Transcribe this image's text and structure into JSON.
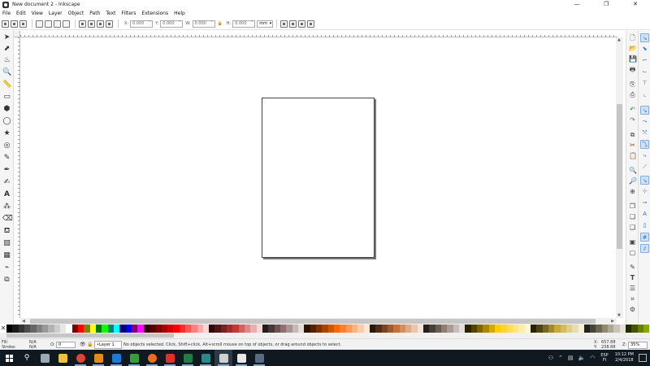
{
  "window": {
    "title": "New document 2 - Inkscape",
    "minimize": "—",
    "maximize": "❐",
    "close": "✕"
  },
  "menu": [
    "File",
    "Edit",
    "View",
    "Layer",
    "Object",
    "Path",
    "Text",
    "Filters",
    "Extensions",
    "Help"
  ],
  "controls": {
    "x_label": "X:",
    "x_value": "0.000",
    "y_label": "Y:",
    "y_value": "0.000",
    "w_label": "W:",
    "w_value": "0.000",
    "h_label": "H:",
    "h_value": "0.000",
    "unit": "mm"
  },
  "tools": [
    "selector-tool",
    "node-tool",
    "tweak-tool",
    "zoom-tool",
    "measure-tool",
    "rectangle-tool",
    "3d-box-tool",
    "ellipse-tool",
    "star-tool",
    "spiral-tool",
    "pencil-tool",
    "pen-tool",
    "calligraphy-tool",
    "text-tool",
    "spray-tool",
    "eraser-tool",
    "paint-bucket-tool",
    "gradient-tool",
    "mesh-tool",
    "dropper-tool",
    "connector-tool"
  ],
  "status": {
    "fill_label": "Fill:",
    "fill_value": "N/A",
    "stroke_label": "Stroke:",
    "stroke_value": "N/A",
    "opacity_label": "O:",
    "opacity_value": "0",
    "layer": "•Layer 1",
    "message": "No objects selected. Click, Shift+click, Alt+scroll mouse on top of objects, or drag around objects to select.",
    "x_label": "X:",
    "x_coord": "657.88",
    "y_label": "Y:",
    "y_coord": "238.88",
    "z_label": "Z:",
    "zoom": "35%"
  },
  "palette_colors": [
    "#000000",
    "#1a1a1a",
    "#333333",
    "#4d4d4d",
    "#666666",
    "#808080",
    "#999999",
    "#b3b3b3",
    "#cccccc",
    "#e6e6e6",
    "#ffffff",
    "#800000",
    "#ff0000",
    "#808000",
    "#ffff00",
    "#008000",
    "#00ff00",
    "#008080",
    "#00ffff",
    "#000080",
    "#0000ff",
    "#800080",
    "#ff00ff",
    "#2b0000",
    "#550000",
    "#800000",
    "#aa0000",
    "#d40000",
    "#ff0000",
    "#ff2a2a",
    "#ff5555",
    "#ff8080",
    "#ffaaaa",
    "#ffd5d5",
    "#280b0b",
    "#501616",
    "#782121",
    "#a02c2c",
    "#c83737",
    "#d35f5f",
    "#de8787",
    "#e9afaf",
    "#f4d7d7",
    "#241c1c",
    "#483737",
    "#6c5353",
    "#916f6f",
    "#ac9393",
    "#c8b7b7",
    "#e3dbdb",
    "#2b1100",
    "#552200",
    "#803300",
    "#aa4400",
    "#d45500",
    "#ff6600",
    "#ff7f2a",
    "#ff9955",
    "#ffb380",
    "#ffccaa",
    "#ffe6d5",
    "#28170b",
    "#502d16",
    "#784421",
    "#a05a2c",
    "#c87137",
    "#d38d5f",
    "#deaa87",
    "#e9c6af",
    "#f4e3d7",
    "#241f1c",
    "#483e37",
    "#6c5d53",
    "#917c6f",
    "#ac9d93",
    "#c8beb7",
    "#e3dedb",
    "#2b2200",
    "#554400",
    "#806600",
    "#aa8800",
    "#d4aa00",
    "#ffcc00",
    "#ffd42a",
    "#ffdd55",
    "#ffe680",
    "#ffeeaa",
    "#fff6d5",
    "#28220b",
    "#504416",
    "#786721",
    "#a0892c",
    "#c8ab37",
    "#d3bc5f",
    "#decd87",
    "#e9ddaf",
    "#f4eed7",
    "#24221c",
    "#484537",
    "#6c6753",
    "#918a6f",
    "#aca793",
    "#c8c4b7",
    "#e3e2db",
    "#222b00",
    "#445500",
    "#668000",
    "#88aa00"
  ],
  "taskbar": {
    "apps": [
      {
        "name": "taskview",
        "color": "#9aa8b5"
      },
      {
        "name": "file-explorer",
        "color": "#f0c040"
      },
      {
        "name": "chrome",
        "color": "#dd4433"
      },
      {
        "name": "app-orange",
        "color": "#e08a1e"
      },
      {
        "name": "edge",
        "color": "#1f7ad6"
      },
      {
        "name": "app-green",
        "color": "#3a9a40"
      },
      {
        "name": "firefox",
        "color": "#ef6a1f"
      },
      {
        "name": "app-red",
        "color": "#d8322a"
      },
      {
        "name": "excel",
        "color": "#1e7e45"
      },
      {
        "name": "app-teal",
        "color": "#2a8a8a"
      },
      {
        "name": "inkscape",
        "color": "#d0d0d0"
      },
      {
        "name": "inkscape-2",
        "color": "#e8e8e8"
      },
      {
        "name": "photos",
        "color": "#5a6a80"
      }
    ],
    "lang_top": "ESP",
    "lang_bottom": "FI",
    "time": "10:12 PM",
    "date": "2/4/2018"
  }
}
